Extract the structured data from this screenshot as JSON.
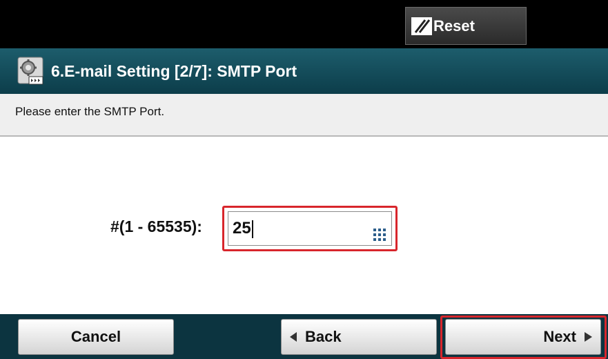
{
  "topbar": {
    "reset_label": "Reset"
  },
  "title": {
    "text": "6.E-mail Setting [2/7]: SMTP Port"
  },
  "instruction": {
    "text": "Please enter the SMTP Port."
  },
  "field": {
    "label": "#(1 - 65535):",
    "value": "25"
  },
  "buttons": {
    "cancel": "Cancel",
    "back": "Back",
    "next": "Next"
  },
  "colors": {
    "highlight": "#d8262c",
    "titlebar": "#1d5d6c",
    "bottombar": "#0c3440"
  }
}
